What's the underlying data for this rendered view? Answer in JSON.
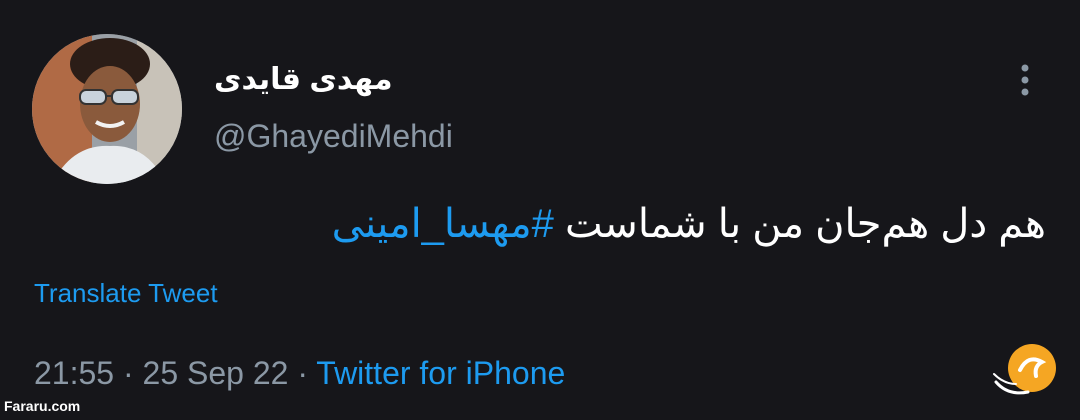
{
  "tweet": {
    "author": {
      "display_name": "مهدی قایدی",
      "handle": "@GhayediMehdi"
    },
    "text_main": "هم دل هم‌جان من با شماست ",
    "hashtag": "#مهسا_امینی",
    "translate_label": "Translate Tweet",
    "time": "21:55",
    "separator": "·",
    "date": "25 Sep 22",
    "source": "Twitter for iPhone"
  },
  "watermark": {
    "site": "Fararu.com",
    "logo_text": "فرارو"
  },
  "icons": {
    "more": "more-vertical-icon",
    "logo": "fararu-logo-icon"
  },
  "colors": {
    "background": "#16161a",
    "link": "#1d9bf0",
    "secondary_text": "#8b98a5",
    "primary_text": "#ffffff",
    "logo_orange": "#f5a623"
  }
}
